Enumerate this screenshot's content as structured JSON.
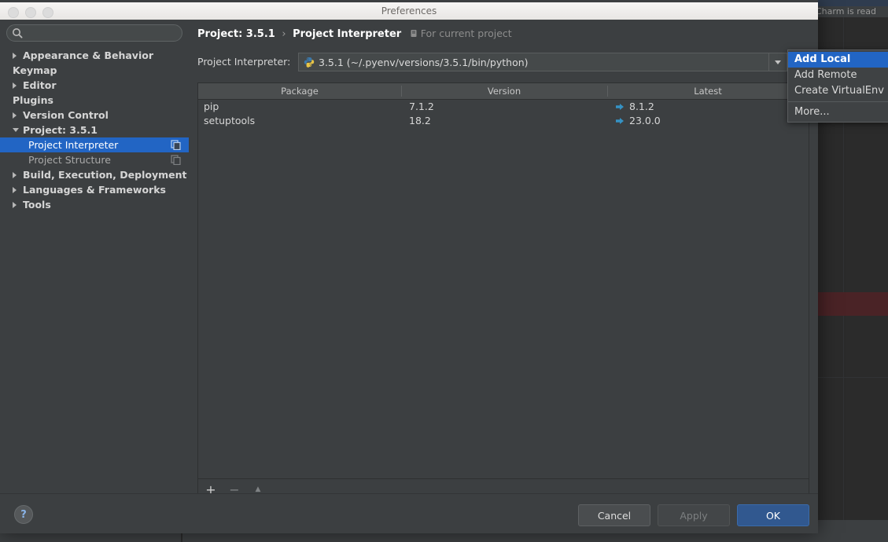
{
  "background": {
    "status_text": "Charm is read"
  },
  "window": {
    "title": "Preferences",
    "traffic_lights": [
      "close",
      "minimize",
      "zoom"
    ]
  },
  "search": {
    "value": "",
    "placeholder": "",
    "icon": "search-icon"
  },
  "sidebar": {
    "items": [
      {
        "label": "Appearance & Behavior",
        "arrow": "closed",
        "level": 0,
        "bold": true,
        "selected": false,
        "icon": null
      },
      {
        "label": "Keymap",
        "arrow": null,
        "level": 0,
        "bold": true,
        "selected": false,
        "icon": null
      },
      {
        "label": "Editor",
        "arrow": "closed",
        "level": 0,
        "bold": true,
        "selected": false,
        "icon": null
      },
      {
        "label": "Plugins",
        "arrow": null,
        "level": 0,
        "bold": true,
        "selected": false,
        "icon": null
      },
      {
        "label": "Version Control",
        "arrow": "closed",
        "level": 0,
        "bold": true,
        "selected": false,
        "icon": null
      },
      {
        "label": "Project: 3.5.1",
        "arrow": "open",
        "level": 0,
        "bold": true,
        "selected": false,
        "icon": null
      },
      {
        "label": "Project Interpreter",
        "arrow": null,
        "level": 1,
        "bold": false,
        "selected": true,
        "icon": "copy-icon"
      },
      {
        "label": "Project Structure",
        "arrow": null,
        "level": 1,
        "bold": false,
        "selected": false,
        "icon": "copy-icon"
      },
      {
        "label": "Build, Execution, Deployment",
        "arrow": "closed",
        "level": 0,
        "bold": true,
        "selected": false,
        "icon": null
      },
      {
        "label": "Languages & Frameworks",
        "arrow": "closed",
        "level": 0,
        "bold": true,
        "selected": false,
        "icon": null
      },
      {
        "label": "Tools",
        "arrow": "closed",
        "level": 0,
        "bold": true,
        "selected": false,
        "icon": null
      }
    ]
  },
  "breadcrumb": {
    "project": "Project: 3.5.1",
    "separator": "›",
    "page": "Project Interpreter",
    "note": "For current project",
    "note_icon": "scope-icon"
  },
  "interpreter": {
    "label": "Project Interpreter:",
    "value": "3.5.1 (~/.pyenv/versions/3.5.1/bin/python)",
    "icon": "python-icon",
    "dropdown_icon": "chevron-down-icon"
  },
  "packages": {
    "columns": [
      "Package",
      "Version",
      "Latest"
    ],
    "rows": [
      {
        "package": "pip",
        "version": "7.1.2",
        "latest": "8.1.2",
        "latest_icon": "upgrade-arrow-icon"
      },
      {
        "package": "setuptools",
        "version": "18.2",
        "latest": "23.0.0",
        "latest_icon": "upgrade-arrow-icon"
      }
    ],
    "toolbar": [
      {
        "name": "add-package-button",
        "glyph": "+",
        "enabled": true
      },
      {
        "name": "remove-package-button",
        "glyph": "−",
        "enabled": false
      },
      {
        "name": "upgrade-package-button",
        "glyph": "▲",
        "enabled": false
      }
    ]
  },
  "menu": {
    "items": [
      {
        "label": "Add Local",
        "selected": true,
        "separator_after": false
      },
      {
        "label": "Add Remote",
        "selected": false,
        "separator_after": false
      },
      {
        "label": "Create VirtualEnv",
        "selected": false,
        "separator_after": true
      },
      {
        "label": "More...",
        "selected": false,
        "separator_after": false
      }
    ]
  },
  "footer": {
    "help_label": "?",
    "cancel_label": "Cancel",
    "apply_label": "Apply",
    "ok_label": "OK"
  },
  "colors": {
    "accent": "#2265c4",
    "dialog_bg": "#3c3f41",
    "primary_button": "#31588f",
    "upgrade_arrow": "#3592c4"
  }
}
